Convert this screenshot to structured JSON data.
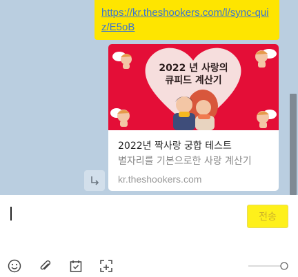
{
  "chat": {
    "link_message": "https://kr.theshookers.com/l/sync-quiz/E5oB",
    "preview": {
      "image_title_line1": "2022 년 사랑의",
      "image_title_line2": "큐피드 계산기",
      "title": "2022년 짝사랑 궁합 테스트",
      "description": "별자리를 기본으로한 사랑 계산기",
      "domain": "kr.theshookers.com"
    }
  },
  "input": {
    "send_label": "전송"
  },
  "toolbar": {
    "icons": [
      "emoji-icon",
      "paperclip-icon",
      "calendar-check-icon",
      "capture-icon"
    ]
  },
  "colors": {
    "chat_background": "#bacee0",
    "bubble": "#fee500",
    "link": "#3a75d0",
    "image_red": "#e40e37",
    "send_button": "#fef01b"
  }
}
